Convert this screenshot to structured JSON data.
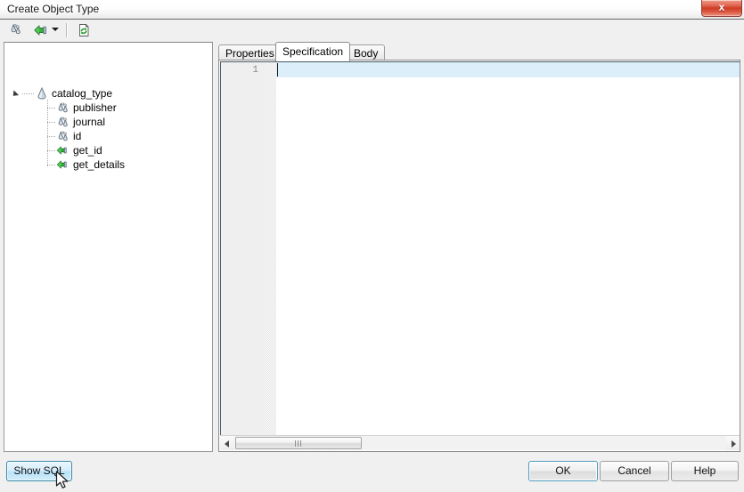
{
  "window": {
    "title": "Create Object Type",
    "close_label": "x",
    "close_icon": "close-icon"
  },
  "toolbar": {
    "items": [
      {
        "name": "add-attribute-button",
        "icon": "attribute-droplets-icon",
        "x": 8
      },
      {
        "name": "add-method-button",
        "icon": "green-arrow-method-icon",
        "x": 36
      },
      {
        "name": "add-method-dropdown",
        "icon": "chevron-down-icon",
        "x": 56
      },
      {
        "name": "refresh-button",
        "icon": "refresh-page-icon",
        "x": 85
      }
    ]
  },
  "tree": {
    "root": {
      "label": "catalog_type",
      "icon": "object-type-icon",
      "expanded": true
    },
    "children": [
      {
        "label": "publisher",
        "icon": "attribute-droplets-icon"
      },
      {
        "label": "journal",
        "icon": "attribute-droplets-icon"
      },
      {
        "label": "id",
        "icon": "attribute-droplets-icon"
      },
      {
        "label": "get_id",
        "icon": "green-arrow-method-icon"
      },
      {
        "label": "get_details",
        "icon": "green-arrow-method-icon"
      }
    ]
  },
  "tabs": [
    {
      "label": "Properties",
      "active": false
    },
    {
      "label": "Specification",
      "active": true
    },
    {
      "label": "Body",
      "active": false
    }
  ],
  "editor": {
    "line_numbers": [
      "1"
    ],
    "content": "",
    "current_line": 1
  },
  "scrollbar": {
    "left_arrow_icon": "triangle-left-icon",
    "right_arrow_icon": "triangle-right-icon",
    "grip_icon": "grip-lines-icon"
  },
  "buttons": {
    "show_sql": "Show SQL",
    "ok": "OK",
    "cancel": "Cancel",
    "help": "Help"
  },
  "colors": {
    "accent_selection": "#ddeefb",
    "default_button_border": "#4f9bbd",
    "hover_button_border": "#3c8ba8",
    "close_button": "#cf3d26",
    "method_icon": "#2faa33",
    "window_background": "#f0f0f0"
  }
}
